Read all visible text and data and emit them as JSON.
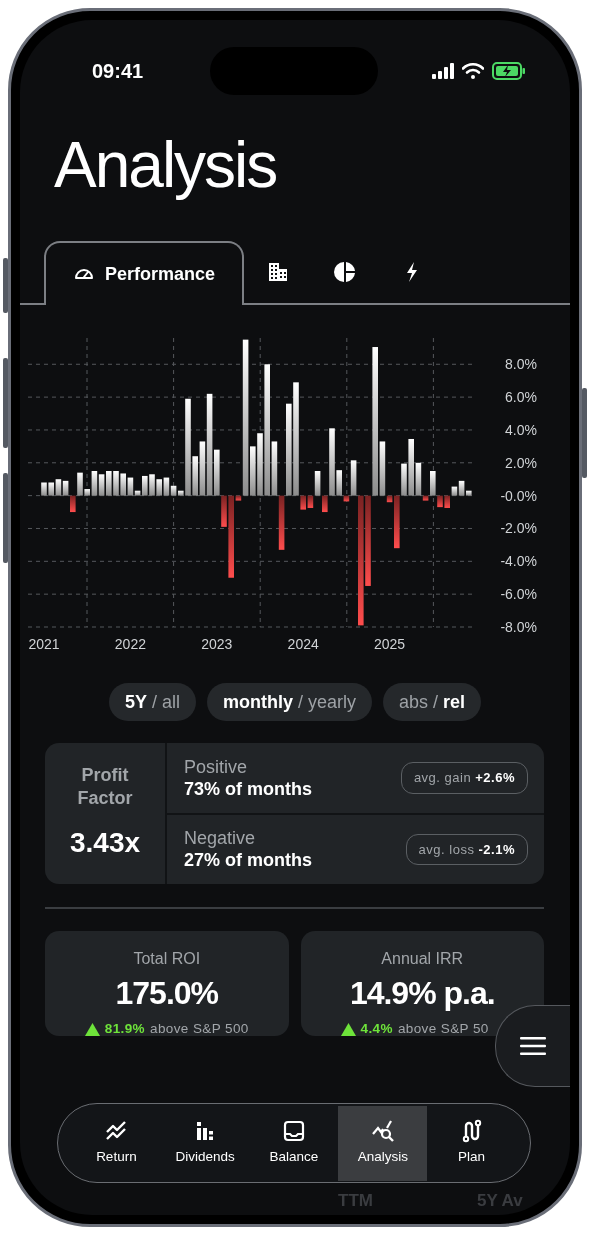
{
  "status_bar": {
    "time": "09:41"
  },
  "title": "Analysis",
  "tabs": [
    {
      "kind": "gauge",
      "label": "Performance",
      "selected": true
    },
    {
      "kind": "building",
      "selected": false
    },
    {
      "kind": "pie",
      "selected": false
    },
    {
      "kind": "bolt",
      "selected": false
    }
  ],
  "chart": {
    "chart_data": {
      "type": "bar",
      "categories": [
        "2021",
        null,
        null,
        null,
        null,
        null,
        null,
        null,
        null,
        null,
        null,
        null,
        "2022",
        null,
        null,
        null,
        null,
        null,
        null,
        null,
        null,
        null,
        null,
        null,
        "2023",
        null,
        null,
        null,
        null,
        null,
        null,
        null,
        null,
        null,
        null,
        null,
        "2024",
        null,
        null,
        null,
        null,
        null,
        null,
        null,
        null,
        null,
        null,
        null,
        "2025",
        null,
        null,
        null,
        null,
        null,
        null,
        null,
        null,
        null,
        null,
        null
      ],
      "values": [
        0.8,
        0.8,
        1.0,
        0.9,
        -1.0,
        1.4,
        0.4,
        1.5,
        1.3,
        1.5,
        1.5,
        1.35,
        1.1,
        0.3,
        1.2,
        1.3,
        1.0,
        1.1,
        0.6,
        0.3,
        5.9,
        2.4,
        3.3,
        6.2,
        2.8,
        -1.9,
        -5.0,
        -0.3,
        9.5,
        3.0,
        3.8,
        8.0,
        3.3,
        -3.3,
        5.6,
        6.9,
        -0.85,
        -0.75,
        1.5,
        -1.0,
        4.1,
        1.55,
        -0.35,
        2.15,
        -7.9,
        -5.5,
        9.05,
        3.3,
        -0.4,
        -3.2,
        1.95,
        3.45,
        2.0,
        -0.3,
        1.5,
        -0.7,
        -0.75,
        0.55,
        0.9,
        0.3
      ],
      "ylim": [
        -8,
        9.6
      ],
      "grid": true,
      "yticks": [
        {
          "value": 8,
          "label": "8.0%"
        },
        {
          "value": 6,
          "label": "6.0%"
        },
        {
          "value": 4,
          "label": "4.0%"
        },
        {
          "value": 2,
          "label": "2.0%"
        },
        {
          "value": 0,
          "label": "-0.0%"
        },
        {
          "value": -2,
          "label": "-2.0%"
        },
        {
          "value": -4,
          "label": "-4.0%"
        },
        {
          "value": -6,
          "label": "-6.0%"
        },
        {
          "value": -8,
          "label": "-8.0%"
        }
      ]
    }
  },
  "toggles": [
    {
      "options": [
        {
          "label": "5Y",
          "selected": true
        },
        {
          "label": "all",
          "selected": false
        }
      ],
      "separator": "/"
    },
    {
      "options": [
        {
          "label": "monthly",
          "selected": true
        },
        {
          "label": "yearly",
          "selected": false
        }
      ],
      "separator": "/"
    },
    {
      "options": [
        {
          "label": "abs",
          "selected": false
        },
        {
          "label": "rel",
          "selected": true
        }
      ],
      "separator": "/"
    }
  ],
  "profit_factor": {
    "label": "Profit Factor",
    "value": "3.43x"
  },
  "month_stats": [
    {
      "label": "Positive",
      "value": "73% of months",
      "badge_label": "avg. gain",
      "badge_value": "+2.6%"
    },
    {
      "label": "Negative",
      "value": "27% of months",
      "badge_label": "avg. loss",
      "badge_value": "-2.1%"
    }
  ],
  "metrics": [
    {
      "label": "Total ROI",
      "value": "175.0%",
      "delta": "81.9%",
      "comparison": "above S&P 500"
    },
    {
      "label": "Annual IRR",
      "value": "14.9% p.a.",
      "delta": "4.4%",
      "comparison": "above S&P 50"
    }
  ],
  "background_labels": [
    "TTM",
    "5Y Av"
  ],
  "nav": [
    {
      "kind": "trend",
      "label": "Return",
      "selected": false
    },
    {
      "kind": "bars",
      "label": "Dividends",
      "selected": false
    },
    {
      "kind": "tray",
      "label": "Balance",
      "selected": false
    },
    {
      "kind": "analysis",
      "label": "Analysis",
      "selected": true
    },
    {
      "kind": "route",
      "label": "Plan",
      "selected": false
    }
  ]
}
